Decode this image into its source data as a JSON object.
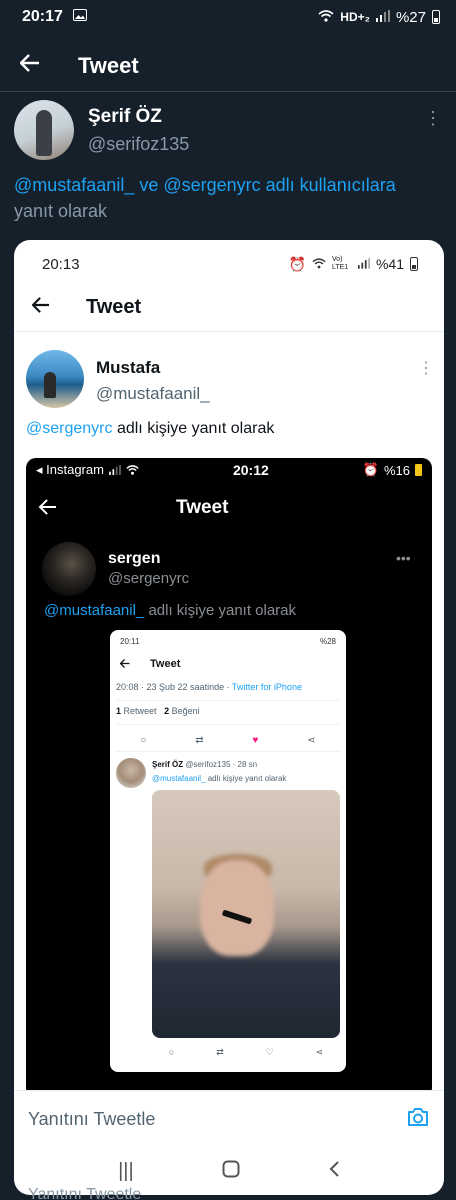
{
  "outer": {
    "status_bar": {
      "time": "20:17",
      "network": "HD+₂",
      "battery": "%27"
    },
    "header": {
      "title": "Tweet"
    },
    "tweet": {
      "name": "Şerif ÖZ",
      "handle": "@serifoz135",
      "reply_mentions": "@mustafaanil_ ve @sergenyrc adlı kullanıcılara",
      "reply_suffix": "yanıt olarak"
    },
    "compose_placeholder": "Yanıtını Tweetle",
    "peek_text": "Yanıtını Tweetle"
  },
  "shot1": {
    "status_bar": {
      "time": "20:13",
      "network": "Vo) LTE1",
      "battery": "%41"
    },
    "header": {
      "title": "Tweet"
    },
    "tweet": {
      "name": "Mustafa",
      "handle": "@mustafaanil_",
      "reply_mention": "@sergenyrc",
      "reply_suffix": "adlı kişiye yanıt olarak"
    }
  },
  "shot2": {
    "status_bar": {
      "app": "◂ Instagram",
      "time": "20:12",
      "battery": "%16"
    },
    "header": {
      "title": "Tweet"
    },
    "tweet": {
      "name": "sergen",
      "handle": "@sergenyrc",
      "reply_mention": "@mustafaanil_",
      "reply_suffix": "adlı kişiye yanıt olarak"
    }
  },
  "shot3": {
    "status_bar": {
      "time": "20:11",
      "battery": "%28"
    },
    "header": {
      "title": "Tweet"
    },
    "meta": "20:08 · 23 Şub 22 saatinde · ",
    "source": "Twitter for iPhone",
    "retweets": "1",
    "retweets_label": "Retweet",
    "likes": "2",
    "likes_label": "Beğeni",
    "reply": {
      "name": "Şerif ÖZ",
      "handle_time": "@serifoz135 · 28 sn",
      "mention": "@mustafaanil_",
      "suffix": "adlı kişiye yanıt olarak"
    }
  }
}
